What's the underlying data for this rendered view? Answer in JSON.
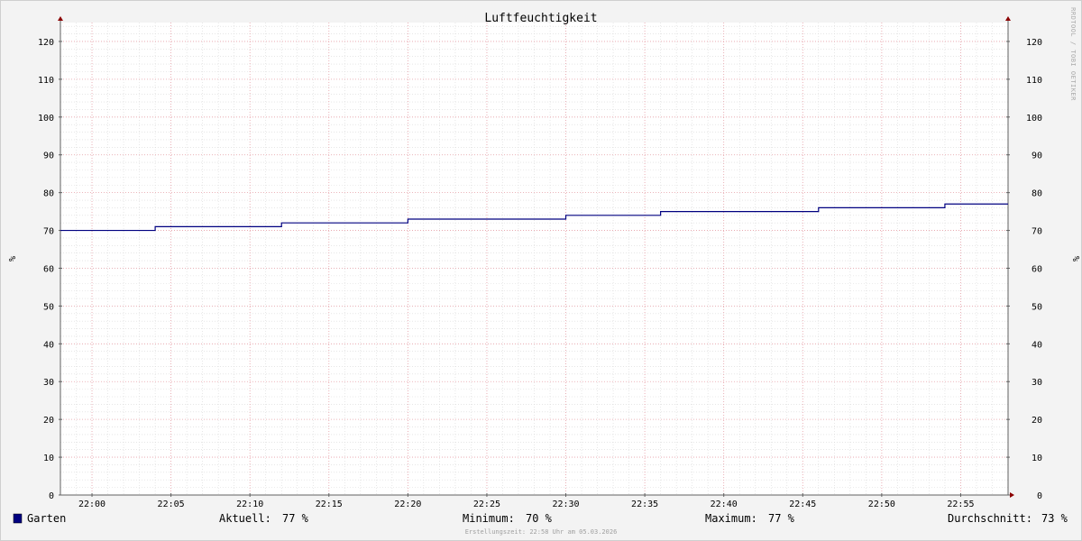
{
  "chart_data": {
    "type": "line",
    "step": true,
    "title": "Luftfeuchtigkeit",
    "ylabel": "%",
    "ylim": [
      0,
      125
    ],
    "yticks": [
      0,
      10,
      20,
      30,
      40,
      50,
      60,
      70,
      80,
      90,
      100,
      110,
      120
    ],
    "xlim": [
      "21:58",
      "22:58"
    ],
    "xticks": [
      "22:00",
      "22:05",
      "22:10",
      "22:15",
      "22:20",
      "22:25",
      "22:30",
      "22:35",
      "22:40",
      "22:45",
      "22:50",
      "22:55"
    ],
    "grid": true,
    "series": [
      {
        "name": "Garten",
        "color": "#000080",
        "x": [
          "21:58",
          "22:04",
          "22:12",
          "22:20",
          "22:30",
          "22:36",
          "22:46",
          "22:54",
          "22:58"
        ],
        "values": [
          70,
          71,
          72,
          73,
          74,
          75,
          76,
          77,
          77
        ]
      }
    ]
  },
  "watermark": "RRDTOOL / TOBI OETIKER",
  "legend": {
    "series_name": "Garten",
    "swatch_color": "#000080",
    "stats": [
      {
        "label": "Aktuell:",
        "value": "77 %"
      },
      {
        "label": "Minimum:",
        "value": "70 %"
      },
      {
        "label": "Maximum:",
        "value": "77 %"
      },
      {
        "label": "Durchschnitt:",
        "value": "73 %"
      }
    ]
  },
  "footer": "Erstellungszeit: 22:58 Uhr am 05.03.2026",
  "colors": {
    "plot_bg": "#ffffff",
    "major_grid": "#e8a0a8",
    "minor_grid": "#d8d8d8",
    "axis": "#606060",
    "arrow": "#8b0000"
  }
}
